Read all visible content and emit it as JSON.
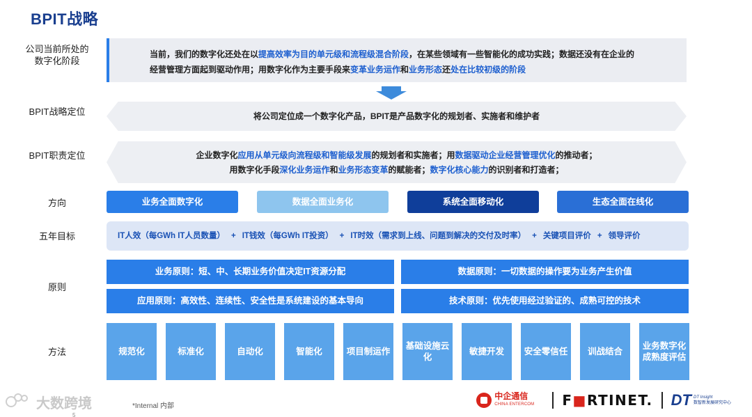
{
  "title": "BPIT战略",
  "labels": {
    "stage": "公司当前所处的数字化阶段",
    "positioning": "BPIT战略定位",
    "duty": "BPIT职责定位",
    "direction": "方向",
    "goals": "五年目标",
    "principles": "原则",
    "methods": "方法"
  },
  "stage_box": {
    "p1": "当前，我们的数字化还处在以",
    "h1": "提高效率为目的单元级和流程级混合阶段",
    "p2": "，在某些领域有一些智能化的成功实践；数据还没有在企业的",
    "p3": "经营管理方面起到驱动作用；用数字化作为主要手段来",
    "h2": "变革业务运作",
    "p4": "和",
    "h3": "业务形态",
    "p5": "还",
    "h4": "处在比较初级的阶段"
  },
  "positioning_text": "将公司定位成一个数字化产品，BPIT是产品数字化的规划者、实施者和维护者",
  "duty": {
    "l1_a": "企业数字化",
    "l1_h1": "应用从单元级向流程级和智能级发展",
    "l1_b": "的规划者和实施者；用",
    "l1_h2": "数据驱动企业经营管理优化",
    "l1_c": "的推动者；",
    "l2_a": "用数字化手段",
    "l2_h1": "深化业务运作",
    "l2_b": "和",
    "l2_h2": "业务形态变革",
    "l2_c": "的赋能者；",
    "l2_h3": "数字化核心能力",
    "l2_d": "的识别者和打造者；"
  },
  "directions": [
    {
      "label": "业务全面数字化",
      "color": "#2a7ee8"
    },
    {
      "label": "数据全面业务化",
      "color": "#8ec5ee"
    },
    {
      "label": "系统全面移动化",
      "color": "#0f3e9a"
    },
    {
      "label": "生态全面在线化",
      "color": "#2a6fd6"
    }
  ],
  "goals": {
    "g1": "IT人效（每GWh IT人员数量）",
    "g2": "IT钱效（每GWh IT投资）",
    "g3": "IT时效（需求到上线、问题到解决的交付及时率）",
    "g4": "关键项目评价",
    "g5": "领导评价",
    "plus": "+"
  },
  "principles": {
    "business": "业务原则：短、中、长期业务价值决定IT资源分配",
    "data": "数据原则：一切数据的操作要为业务产生价值",
    "application": "应用原则：高效性、连续性、安全性是系统建设的基本导向",
    "technology": "技术原则：优先使用经过验证的、成熟可控的技术"
  },
  "methods": [
    "规范化",
    "标准化",
    "自动化",
    "智能化",
    "项目制运作",
    "基础设施云化",
    "敏捷开发",
    "安全零信任",
    "训战结合",
    "业务数字化成熟度评估"
  ],
  "footer": {
    "internal": "*Internal 内部",
    "page": "5",
    "watermark": "大数跨境"
  },
  "logos": {
    "cec_cn": "中企通信",
    "cec_en": "CHINA ENTERCOM",
    "fortinet_a": "F",
    "fortinet_red": "",
    "fortinet_b": "RTINET.",
    "dt": "DT",
    "dt_en": "DT Insight",
    "dt_cn": "数智新发展研究中心"
  },
  "colors": {
    "title": "#1a3f8f",
    "accent": "#2a7ee8",
    "highlight": "#1d5fcf",
    "method": "#5aa4ea"
  }
}
